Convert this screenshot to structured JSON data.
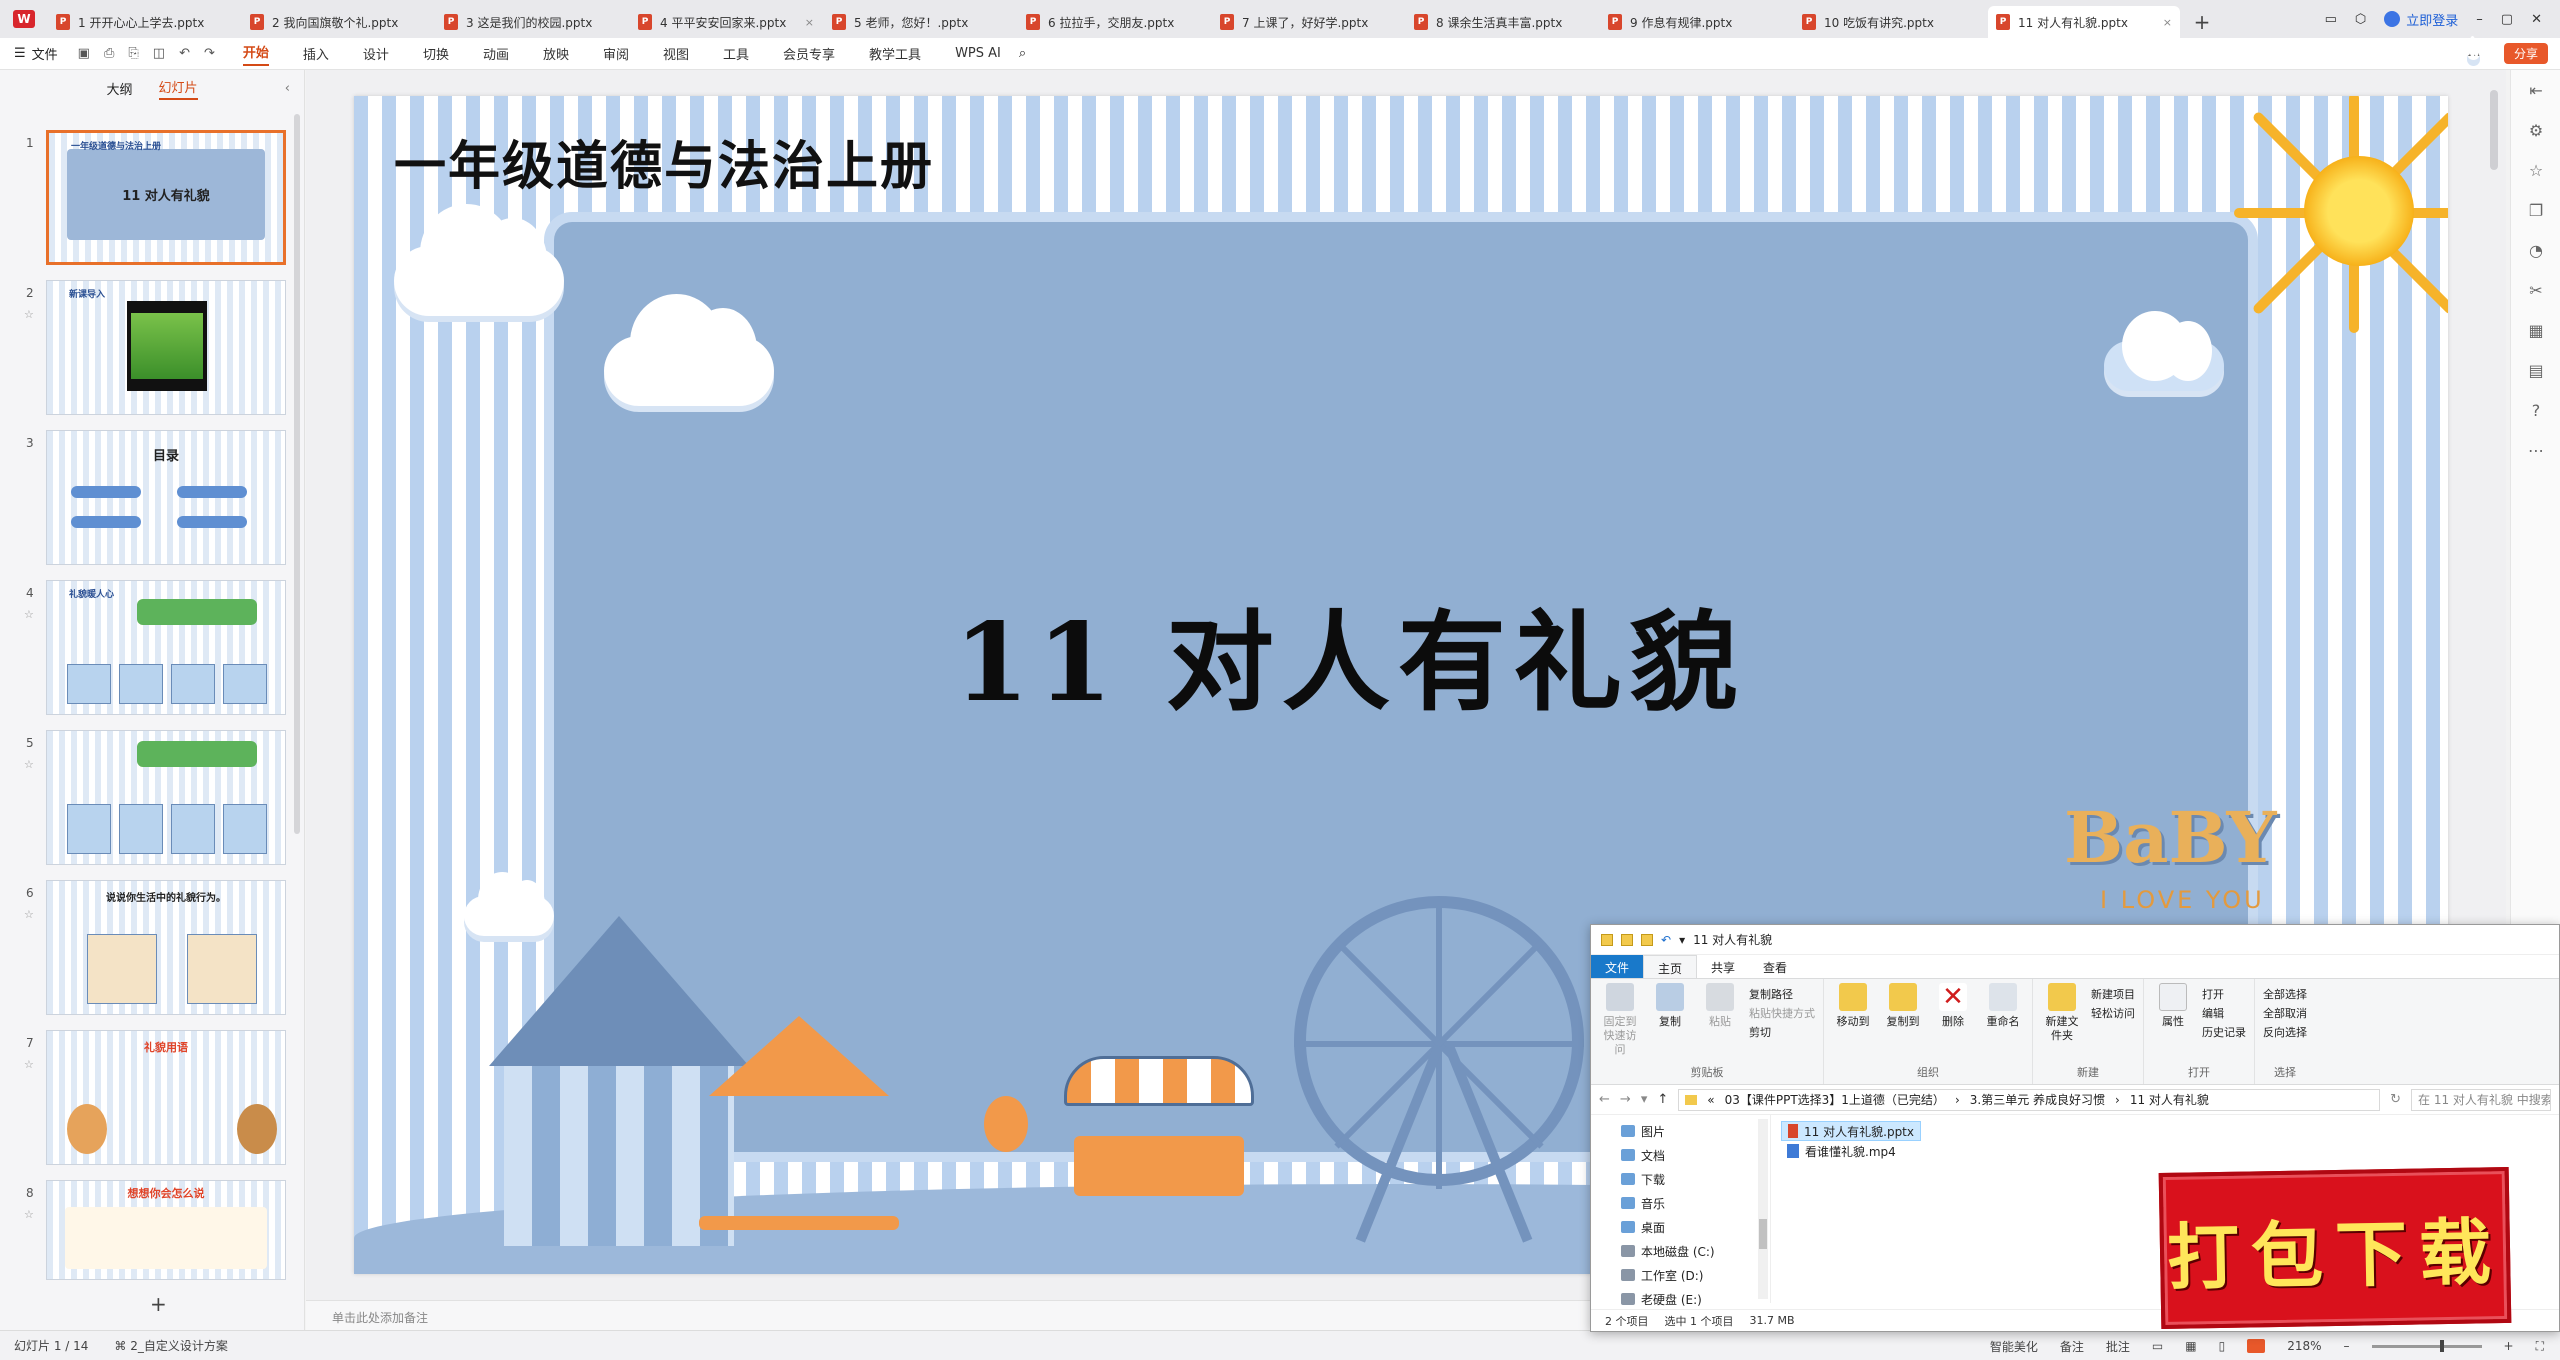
{
  "tabs": [
    {
      "label": "1 开开心心上学去.pptx"
    },
    {
      "label": "2 我向国旗敬个礼.pptx"
    },
    {
      "label": "3 这是我们的校园.pptx"
    },
    {
      "label": "4 平平安安回家来.pptx"
    },
    {
      "label": "5 老师，您好！.pptx"
    },
    {
      "label": "6 拉拉手，交朋友.pptx"
    },
    {
      "label": "7 上课了，好好学.pptx"
    },
    {
      "label": "8 课余生活真丰富.pptx"
    },
    {
      "label": "9 作息有规律.pptx"
    },
    {
      "label": "10 吃饭有讲究.pptx"
    },
    {
      "label": "11 对人有礼貌.pptx"
    }
  ],
  "tabbar": {
    "login": "立即登录"
  },
  "menubar": {
    "file": "文件",
    "items": [
      "开始",
      "插入",
      "设计",
      "切换",
      "动画",
      "放映",
      "审阅",
      "视图",
      "工具",
      "会员专享",
      "教学工具"
    ],
    "wps_ai": "WPS AI",
    "share": "分享"
  },
  "sidepanel": {
    "tab_outline": "大纲",
    "tab_slides": "幻灯片",
    "thumbs": [
      {
        "num": "1",
        "title": "11 对人有礼貌",
        "head": "一年级道德与法治上册"
      },
      {
        "num": "2",
        "title": "",
        "head": "新课导入"
      },
      {
        "num": "3",
        "title": "目录",
        "head": ""
      },
      {
        "num": "4",
        "title": "",
        "head": "礼貌暖人心"
      },
      {
        "num": "5",
        "title": "",
        "head": ""
      },
      {
        "num": "6",
        "title": "说说你生活中的礼貌行为。",
        "head": ""
      },
      {
        "num": "7",
        "title": "礼貌用语",
        "head": ""
      },
      {
        "num": "8",
        "title": "想想你会怎么说",
        "head": ""
      }
    ]
  },
  "slide": {
    "header": "一年级道德与法治上册",
    "title": "11  对人有礼貌",
    "baby": "BaBY",
    "ilove": "I LOVE YOU"
  },
  "notes": {
    "placeholder": "单击此处添加备注"
  },
  "statusbar": {
    "slide_count": "幻灯片 1 / 14",
    "design": "2_自定义设计方案",
    "beautify": "智能美化",
    "notes": "备注",
    "comments": "批注",
    "zoom": "218%"
  },
  "explorer": {
    "title": "11 对人有礼貌",
    "tabs": {
      "file": "文件",
      "home": "主页",
      "share": "共享",
      "view": "查看"
    },
    "ribbon": {
      "pin": "固定到快速访问",
      "copy": "复制",
      "paste": "粘贴",
      "copy_path": "复制路径",
      "paste_shortcut": "粘贴快捷方式",
      "cut": "剪切",
      "clipboard": "剪贴板",
      "move_to": "移动到",
      "copy_to": "复制到",
      "delete": "删除",
      "rename": "重命名",
      "organize": "组织",
      "new_folder": "新建文件夹",
      "new_item": "新建项目",
      "easy_access": "轻松访问",
      "new_group": "新建",
      "properties": "属性",
      "open": "打开",
      "edit": "编辑",
      "history": "历史记录",
      "open_group": "打开",
      "select_all": "全部选择",
      "select_none": "全部取消",
      "invert": "反向选择",
      "select_group": "选择"
    },
    "path": [
      "03【课件PPT选择3】1上道德（已完结）",
      "3.第三单元 养成良好习惯",
      "11 对人有礼貌"
    ],
    "search_placeholder": "在 11 对人有礼貌 中搜索",
    "nav": [
      "图片",
      "文档",
      "下载",
      "音乐",
      "桌面",
      "本地磁盘 (C:)",
      "工作室 (D:)",
      "老硬盘 (E:)"
    ],
    "files": [
      "11 对人有礼貌.pptx",
      "看谁懂礼貌.mp4"
    ],
    "status": {
      "items": "2 个项目",
      "selected": "选中 1 个项目",
      "size": "31.7 MB"
    }
  },
  "stamp": {
    "text": "打包下载"
  },
  "colors": {
    "accent": "#d44a16",
    "slide_panel": "#91afd2",
    "stamp": "#d9111c"
  }
}
